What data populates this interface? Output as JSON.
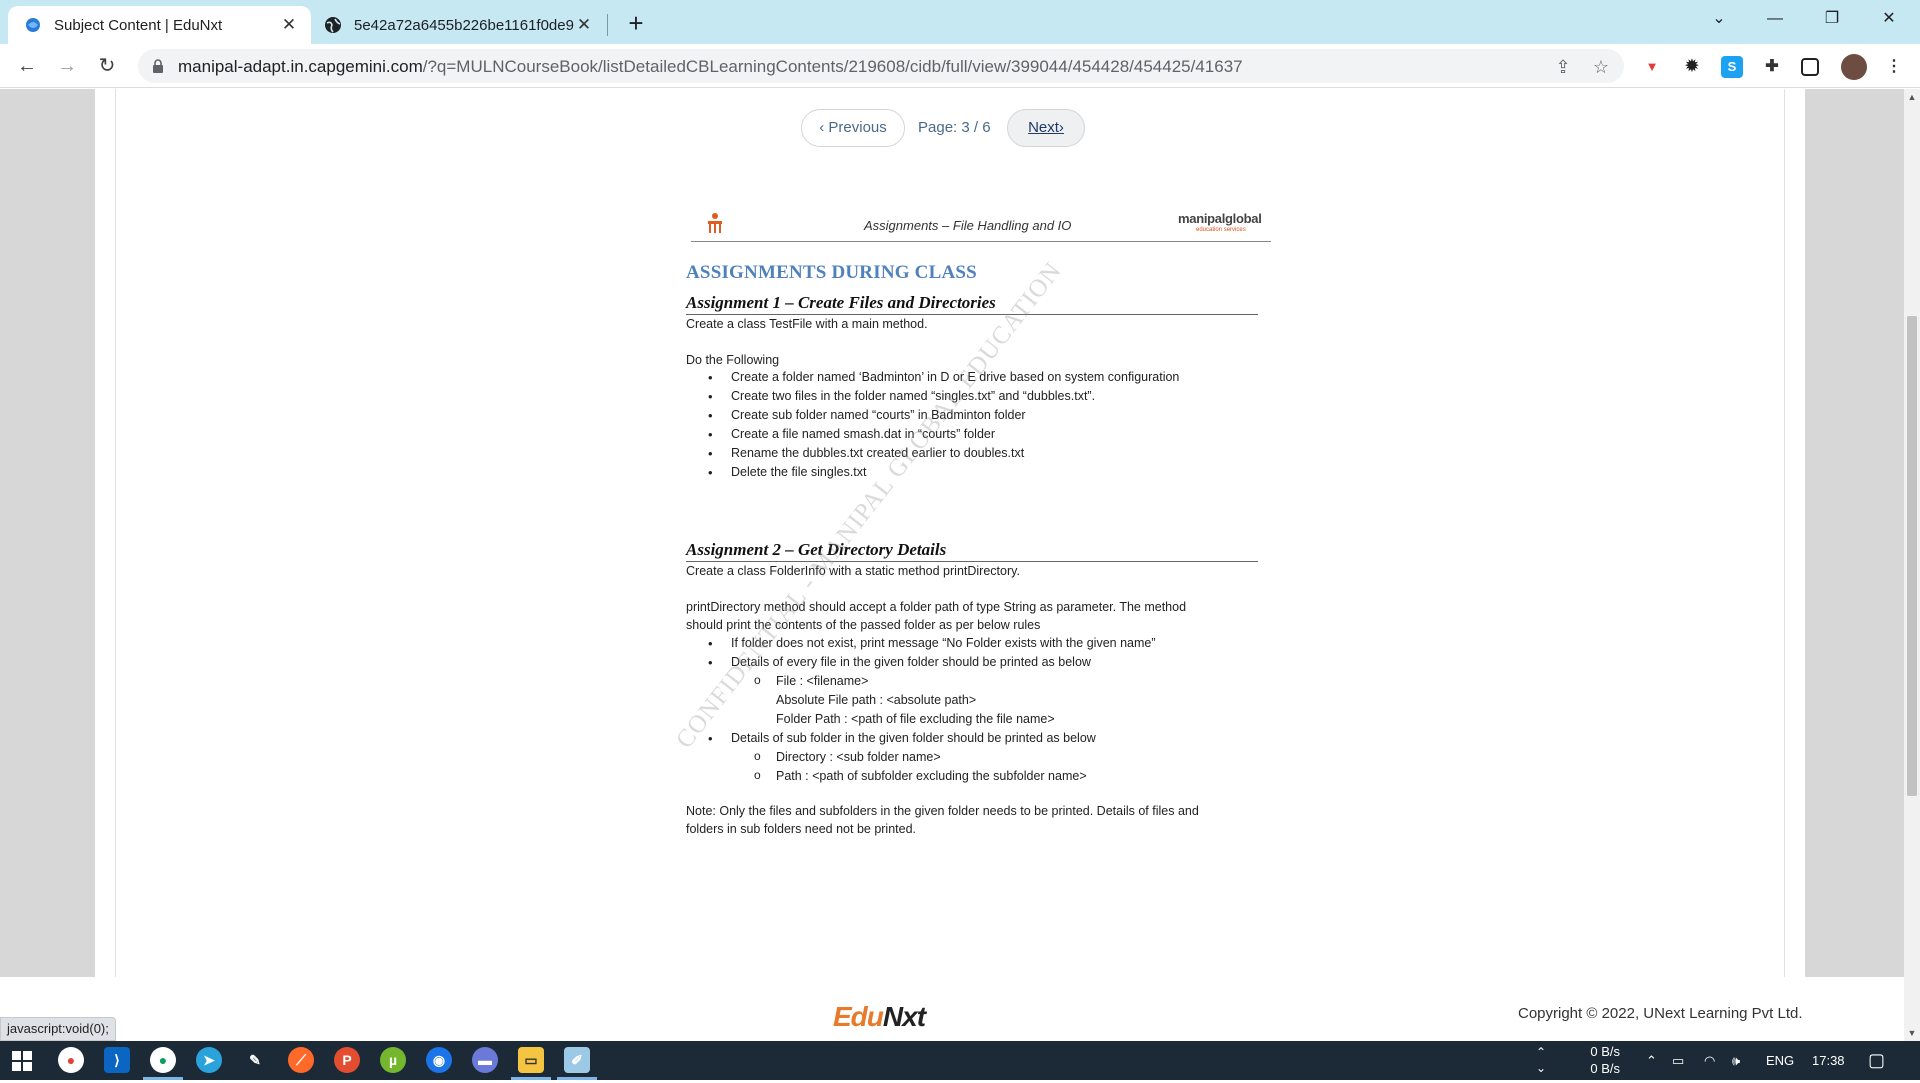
{
  "browser": {
    "tabs": [
      {
        "title": "Subject Content | EduNxt",
        "active": true
      },
      {
        "title": "5e42a72a6455b226be1161f0de9",
        "active": false
      }
    ],
    "url_host": "manipal-adapt.in.capgemini.com",
    "url_path": "/?q=MULNCourseBook/listDetailedCBLearningContents/219608/cidb/full/view/399044/454428/454425/41637",
    "status_url": "javascript:void(0);"
  },
  "pager": {
    "previous_label": "Previous",
    "page_label": "Page: 3 / 6",
    "next_label": "Next"
  },
  "document": {
    "header_title": "Assignments – File Handling and IO",
    "brand": "manipalglobal",
    "brand_sub": "education services",
    "section_title": "ASSIGNMENTS DURING CLASS",
    "assignment1": {
      "title": "Assignment 1 – Create Files and Directories",
      "intro": "Create a class TestFile with a main method.",
      "lead": "Do the Following",
      "items": [
        "Create a folder named ‘Badminton’ in D or E drive based on system configuration",
        "Create two files in the folder named “singles.txt” and “dubbles.txt”.",
        "Create sub folder named “courts” in Badminton folder",
        "Create a file named smash.dat in “courts” folder",
        "Rename the dubbles.txt created earlier to doubles.txt",
        "Delete the file singles.txt"
      ]
    },
    "assignment2": {
      "title": "Assignment 2 – Get Directory Details",
      "intro": "Create a class FolderInfo with a static method printDirectory.",
      "para1_line1": "printDirectory method should accept a folder path of type String as parameter. The method",
      "para1_line2": "should print the contents of the passed folder as per below rules",
      "bullet1": "If folder does not exist, print message “No Folder exists with the given name”",
      "bullet2": "Details of every file in the given folder should be printed as below",
      "file_line1": "File : <filename>",
      "file_line2": "Absolute File path : <absolute path>",
      "file_line3": "Folder Path : <path of file excluding the file name>",
      "bullet3": "Details of sub folder in the given folder should be printed as below",
      "dir_line1": "Directory : <sub folder name>",
      "dir_line2": "Path : <path of subfolder excluding the subfolder name>",
      "note_line1": "Note: Only the files and subfolders in the given folder needs to be printed. Details of files and",
      "note_line2": "folders in sub folders need not be printed."
    },
    "watermark": "CONFIDENTIAL - MANIPAL GLOBAL EDUCATION"
  },
  "footer": {
    "logo_part1": "Edu",
    "logo_part2": "N",
    "logo_part3": "xt",
    "copyright": "Copyright © 2022, UNext Learning Pvt Ltd."
  },
  "taskbar": {
    "net_up": "0 B/s",
    "net_down": "0 B/s",
    "lang": "ENG",
    "time": "17:38"
  }
}
